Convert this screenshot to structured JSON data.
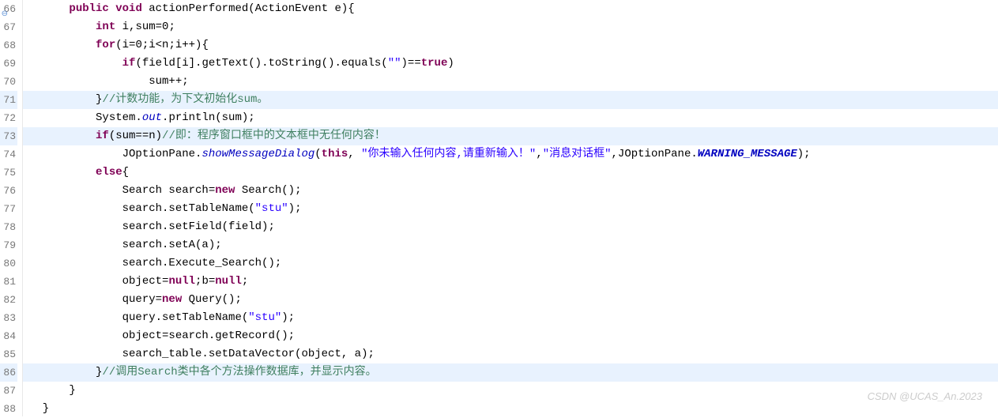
{
  "gutter": {
    "lines": [
      {
        "num": "66",
        "hl": false,
        "marker": "⊖"
      },
      {
        "num": "67",
        "hl": false,
        "marker": ""
      },
      {
        "num": "68",
        "hl": false,
        "marker": ""
      },
      {
        "num": "69",
        "hl": false,
        "marker": ""
      },
      {
        "num": "70",
        "hl": false,
        "marker": ""
      },
      {
        "num": "71",
        "hl": true,
        "marker": ""
      },
      {
        "num": "72",
        "hl": false,
        "marker": ""
      },
      {
        "num": "73",
        "hl": true,
        "marker": ""
      },
      {
        "num": "74",
        "hl": false,
        "marker": ""
      },
      {
        "num": "75",
        "hl": false,
        "marker": ""
      },
      {
        "num": "76",
        "hl": false,
        "marker": ""
      },
      {
        "num": "77",
        "hl": false,
        "marker": ""
      },
      {
        "num": "78",
        "hl": false,
        "marker": ""
      },
      {
        "num": "79",
        "hl": false,
        "marker": ""
      },
      {
        "num": "80",
        "hl": false,
        "marker": ""
      },
      {
        "num": "81",
        "hl": false,
        "marker": ""
      },
      {
        "num": "82",
        "hl": false,
        "marker": ""
      },
      {
        "num": "83",
        "hl": false,
        "marker": ""
      },
      {
        "num": "84",
        "hl": false,
        "marker": ""
      },
      {
        "num": "85",
        "hl": false,
        "marker": ""
      },
      {
        "num": "86",
        "hl": true,
        "marker": ""
      },
      {
        "num": "87",
        "hl": false,
        "marker": ""
      },
      {
        "num": "88",
        "hl": false,
        "marker": ""
      }
    ]
  },
  "code": {
    "lines": [
      {
        "hl": false,
        "tokens": [
          [
            "plain",
            "      "
          ],
          [
            "kw",
            "public"
          ],
          [
            "plain",
            " "
          ],
          [
            "kw",
            "void"
          ],
          [
            "plain",
            " actionPerformed(ActionEvent e){"
          ]
        ]
      },
      {
        "hl": false,
        "tokens": [
          [
            "plain",
            "          "
          ],
          [
            "kw",
            "int"
          ],
          [
            "plain",
            " i,sum=0;"
          ]
        ]
      },
      {
        "hl": false,
        "tokens": [
          [
            "plain",
            "          "
          ],
          [
            "kw",
            "for"
          ],
          [
            "plain",
            "(i=0;i<n;i++){"
          ]
        ]
      },
      {
        "hl": false,
        "tokens": [
          [
            "plain",
            "              "
          ],
          [
            "kw",
            "if"
          ],
          [
            "plain",
            "(field[i].getText().toString().equals("
          ],
          [
            "str",
            "\"\""
          ],
          [
            "plain",
            ")=="
          ],
          [
            "kw",
            "true"
          ],
          [
            "plain",
            ")"
          ]
        ]
      },
      {
        "hl": false,
        "tokens": [
          [
            "plain",
            "                  sum++;"
          ]
        ]
      },
      {
        "hl": true,
        "tokens": [
          [
            "plain",
            "          }"
          ],
          [
            "com",
            "//计数功能，为下文初始化sum。"
          ]
        ]
      },
      {
        "hl": false,
        "tokens": [
          [
            "plain",
            "          System."
          ],
          [
            "it",
            "out"
          ],
          [
            "plain",
            ".println(sum);"
          ]
        ]
      },
      {
        "hl": true,
        "tokens": [
          [
            "plain",
            "          "
          ],
          [
            "kw",
            "if"
          ],
          [
            "plain",
            "(sum==n)"
          ],
          [
            "com",
            "//即：程序窗口框中的文本框中无任何内容！"
          ]
        ]
      },
      {
        "hl": false,
        "tokens": [
          [
            "plain",
            "              JOptionPane."
          ],
          [
            "it",
            "showMessageDialog"
          ],
          [
            "plain",
            "("
          ],
          [
            "kw",
            "this"
          ],
          [
            "plain",
            ", "
          ],
          [
            "str",
            "\"你未输入任何内容,请重新输入！\""
          ],
          [
            "plain",
            ","
          ],
          [
            "str",
            "\"消息对话框\""
          ],
          [
            "plain",
            ",JOptionPane."
          ],
          [
            "itb",
            "WARNING_MESSAGE"
          ],
          [
            "plain",
            ");"
          ]
        ]
      },
      {
        "hl": false,
        "tokens": [
          [
            "plain",
            "          "
          ],
          [
            "kw",
            "else"
          ],
          [
            "plain",
            "{"
          ]
        ]
      },
      {
        "hl": false,
        "tokens": [
          [
            "plain",
            "              Search search="
          ],
          [
            "kw",
            "new"
          ],
          [
            "plain",
            " Search();"
          ]
        ]
      },
      {
        "hl": false,
        "tokens": [
          [
            "plain",
            "              search.setTableName("
          ],
          [
            "str",
            "\"stu\""
          ],
          [
            "plain",
            ");"
          ]
        ]
      },
      {
        "hl": false,
        "tokens": [
          [
            "plain",
            "              search.setField(field);"
          ]
        ]
      },
      {
        "hl": false,
        "tokens": [
          [
            "plain",
            "              search.setA(a);"
          ]
        ]
      },
      {
        "hl": false,
        "tokens": [
          [
            "plain",
            "              search.Execute_Search();"
          ]
        ]
      },
      {
        "hl": false,
        "tokens": [
          [
            "plain",
            "              object="
          ],
          [
            "kw",
            "null"
          ],
          [
            "plain",
            ";b="
          ],
          [
            "kw",
            "null"
          ],
          [
            "plain",
            ";"
          ]
        ]
      },
      {
        "hl": false,
        "tokens": [
          [
            "plain",
            "              query="
          ],
          [
            "kw",
            "new"
          ],
          [
            "plain",
            " Query();"
          ]
        ]
      },
      {
        "hl": false,
        "tokens": [
          [
            "plain",
            "              query.setTableName("
          ],
          [
            "str",
            "\"stu\""
          ],
          [
            "plain",
            ");"
          ]
        ]
      },
      {
        "hl": false,
        "tokens": [
          [
            "plain",
            "              object=search.getRecord();"
          ]
        ]
      },
      {
        "hl": false,
        "tokens": [
          [
            "plain",
            "              search_table.setDataVector(object, a);"
          ]
        ]
      },
      {
        "hl": true,
        "tokens": [
          [
            "plain",
            "          }"
          ],
          [
            "com",
            "//调用Search类中各个方法操作数据库，并显示内容。"
          ]
        ]
      },
      {
        "hl": false,
        "tokens": [
          [
            "plain",
            "      }"
          ]
        ]
      },
      {
        "hl": false,
        "tokens": [
          [
            "plain",
            "  }"
          ]
        ]
      }
    ]
  },
  "watermark": "CSDN @UCAS_An.2023"
}
